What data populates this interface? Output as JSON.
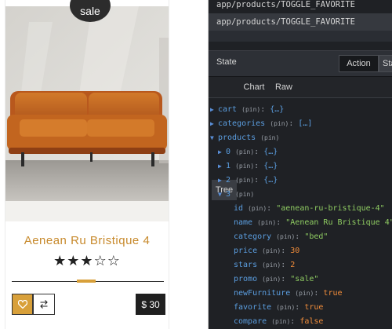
{
  "product_card": {
    "sale_badge": "sale",
    "name": "Aenean Ru Bristique 4",
    "rating_stars": "★★★☆☆",
    "rating": 3,
    "rating_max": 5,
    "price": "$ 30",
    "favorite_icon": "heart-icon",
    "compare_icon": "swap-arrows-icon",
    "accent_color": "#d8a03a",
    "sofa_color": "#c2651f"
  },
  "devtools": {
    "actions": [
      "app/products/TOGGLE_FAVORITE",
      "app/products/TOGGLE_FAVORITE"
    ],
    "state_label": "State",
    "mode_tabs": [
      "Action",
      "State"
    ],
    "view_tabs": [
      "Tree",
      "Chart",
      "Raw"
    ],
    "pin": "(pin)",
    "tree": {
      "cart": "{…}",
      "categories": "[…]",
      "products_key": "products",
      "products_items": [
        {
          "key": "0",
          "value": "{…}"
        },
        {
          "key": "1",
          "value": "{…}"
        },
        {
          "key": "2",
          "value": "{…}"
        }
      ],
      "product3_key": "3",
      "product3_fields": [
        {
          "key": "id",
          "value": "\"aenean-ru-bristique-4\"",
          "type": "str"
        },
        {
          "key": "name",
          "value": "\"Aenean Ru Bristique 4\"",
          "type": "str"
        },
        {
          "key": "category",
          "value": "\"bed\"",
          "type": "str"
        },
        {
          "key": "price",
          "value": "30",
          "type": "num"
        },
        {
          "key": "stars",
          "value": "2",
          "type": "num"
        },
        {
          "key": "promo",
          "value": "\"sale\"",
          "type": "str"
        },
        {
          "key": "newFurniture",
          "value": "true",
          "type": "bool"
        },
        {
          "key": "favorite",
          "value": "true",
          "type": "bool"
        },
        {
          "key": "compare",
          "value": "false",
          "type": "bool"
        }
      ]
    }
  }
}
